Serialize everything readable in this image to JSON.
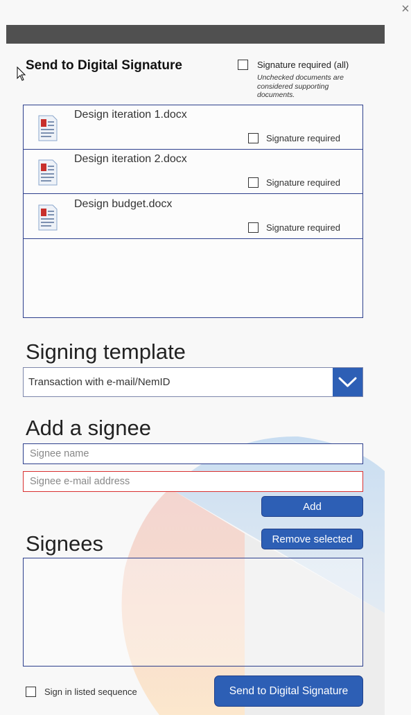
{
  "dialog": {
    "title": "Send to Digital Signature",
    "close_icon": "close-icon"
  },
  "signature_all": {
    "label": "Signature required (all)",
    "note": "Unchecked documents are considered supporting documents.",
    "checked": false
  },
  "documents": [
    {
      "name": "Design iteration 1.docx",
      "signature_label": "Signature required",
      "checked": false,
      "icon": "word-document-icon"
    },
    {
      "name": "Design iteration 2.docx",
      "signature_label": "Signature required",
      "checked": false,
      "icon": "word-document-icon"
    },
    {
      "name": "Design budget.docx",
      "signature_label": "Signature required",
      "checked": false,
      "icon": "word-document-icon"
    }
  ],
  "signing_template": {
    "heading": "Signing template",
    "selected": "Transaction with e-mail/NemID",
    "dropdown_icon": "chevron-down-icon"
  },
  "add_signee": {
    "heading": "Add a signee",
    "name_placeholder": "Signee name",
    "email_placeholder": "Signee e-mail address",
    "add_label": "Add",
    "remove_label": "Remove selected"
  },
  "signees": {
    "heading": "Signees",
    "items": []
  },
  "footer": {
    "sequence_label": "Sign in listed sequence",
    "sequence_checked": false,
    "send_label": "Send to Digital Signature"
  },
  "colors": {
    "accent": "#2d5fb5",
    "border": "#2c3e8c",
    "error_border": "#d93030",
    "header_bar": "#505050"
  }
}
